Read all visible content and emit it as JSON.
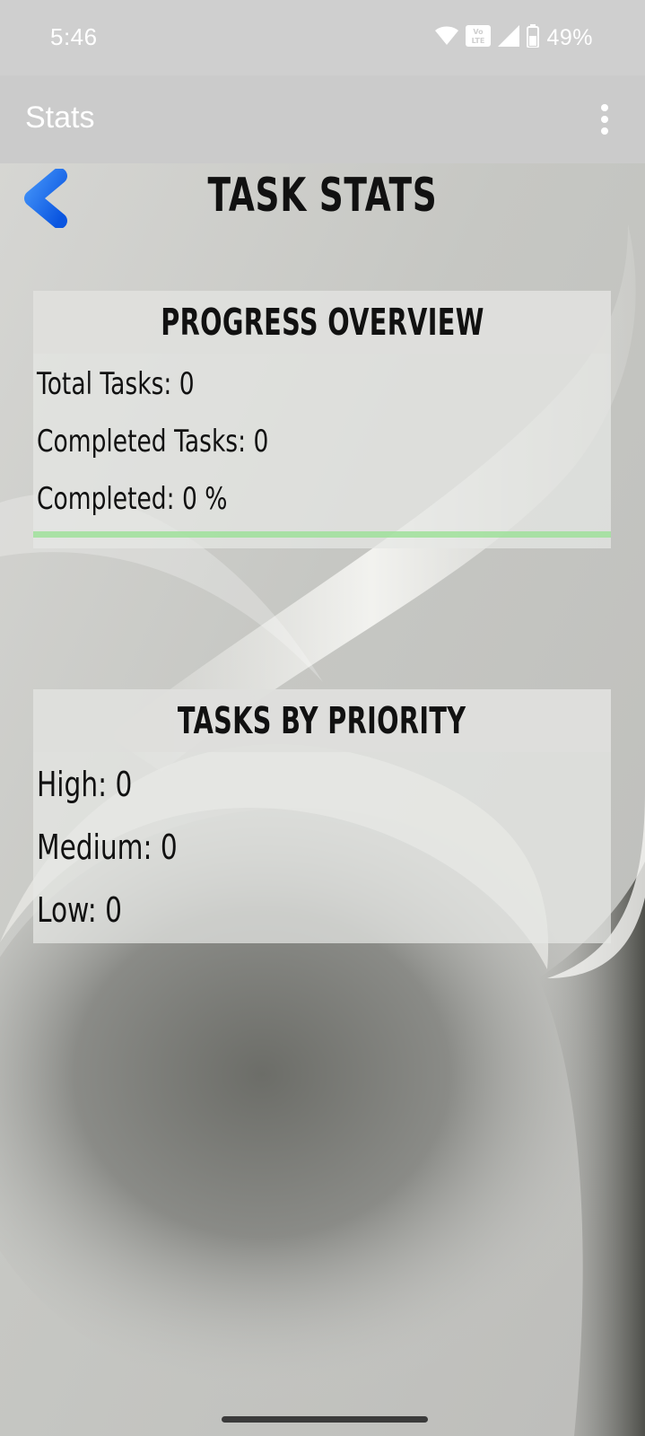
{
  "status_bar": {
    "time": "5:46",
    "battery_percent": "49%",
    "icons": [
      "wifi-icon",
      "volte-icon",
      "signal-icon",
      "battery-icon"
    ]
  },
  "app_bar": {
    "title": "Stats",
    "menu_icon": "more-vert-icon"
  },
  "page": {
    "back_icon": "chevron-left-icon",
    "title": "TASK STATS"
  },
  "progress_overview": {
    "title": "PROGRESS OVERVIEW",
    "total_tasks": "Total Tasks: 0",
    "completed_tasks": "Completed Tasks: 0",
    "completed_percent": "Completed: 0 %",
    "progress_value": 0,
    "progress_color": "#9fe09a"
  },
  "tasks_by_priority": {
    "title": "TASKS BY PRIORITY",
    "high": "High: 0",
    "medium": "Medium: 0",
    "low": "Low: 0"
  },
  "colors": {
    "accent_blue": "#1e6ff0",
    "text_dark": "#111111",
    "bar_gray": "#cbcbcb"
  }
}
